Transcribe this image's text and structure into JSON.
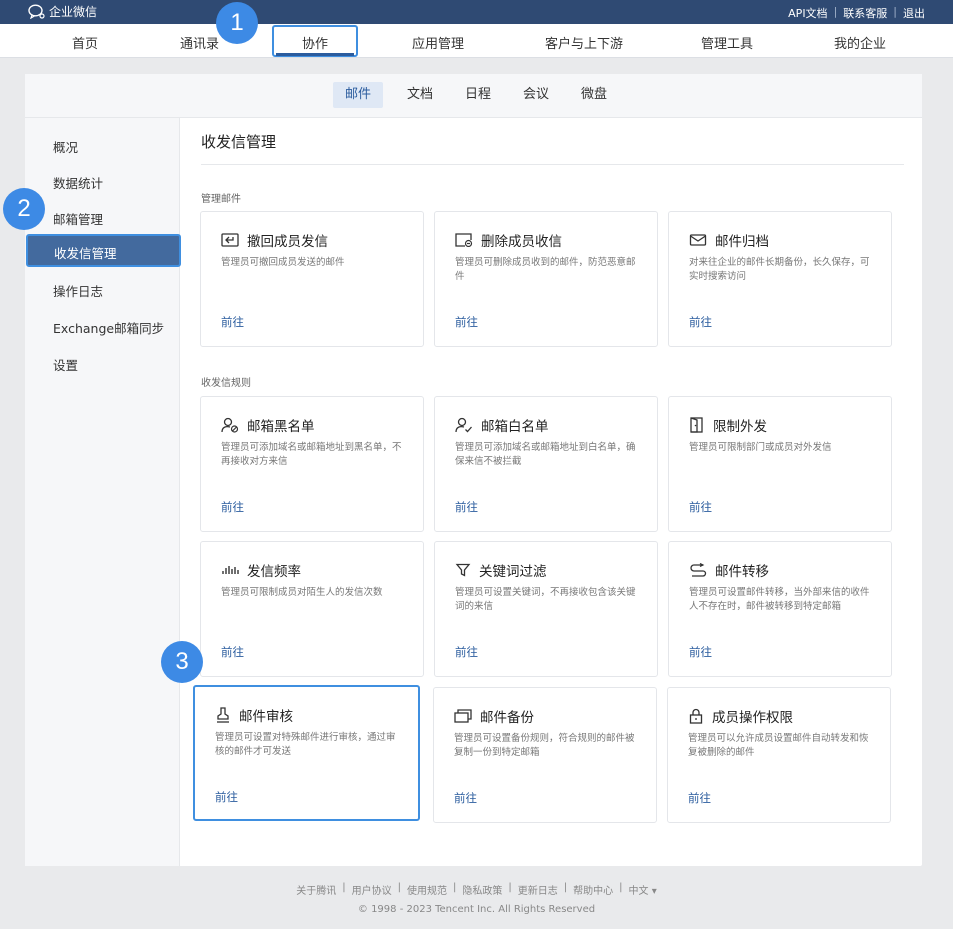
{
  "topbar": {
    "logo_text": "企业微信",
    "links": [
      "API文档",
      "联系客服",
      "退出"
    ]
  },
  "mainnav": {
    "items": [
      "首页",
      "通讯录",
      "协作",
      "应用管理",
      "客户与上下游",
      "管理工具",
      "我的企业"
    ],
    "active": "协作"
  },
  "badges": [
    "1",
    "2",
    "3"
  ],
  "subtabs": {
    "items": [
      "邮件",
      "文档",
      "日程",
      "会议",
      "微盘"
    ],
    "active": "邮件"
  },
  "sidebar": {
    "items": [
      "概况",
      "数据统计",
      "邮箱管理",
      "收发信管理",
      "操作日志",
      "Exchange邮箱同步",
      "设置"
    ],
    "active": "收发信管理"
  },
  "main": {
    "title": "收发信管理",
    "sections": [
      {
        "label": "管理邮件",
        "cards": [
          {
            "icon": "recall-mail-icon",
            "title": "撤回成员发信",
            "desc": "管理员可撤回成员发送的邮件",
            "link": "前往"
          },
          {
            "icon": "delete-mail-icon",
            "title": "删除成员收信",
            "desc": "管理员可删除成员收到的邮件，防范恶意邮件",
            "link": "前往"
          },
          {
            "icon": "archive-mail-icon",
            "title": "邮件归档",
            "desc": "对来往企业的邮件长期备份，长久保存，可实时搜索访问",
            "link": "前往"
          }
        ]
      },
      {
        "label": "收发信规则",
        "cards": [
          {
            "icon": "blacklist-user-icon",
            "title": "邮箱黑名单",
            "desc": "管理员可添加域名或邮箱地址到黑名单，不再接收对方来信",
            "link": "前往"
          },
          {
            "icon": "whitelist-user-icon",
            "title": "邮箱白名单",
            "desc": "管理员可添加域名或邮箱地址到白名单，确保来信不被拦截",
            "link": "前往"
          },
          {
            "icon": "door-exit-icon",
            "title": "限制外发",
            "desc": "管理员可限制部门或成员对外发信",
            "link": "前往"
          },
          {
            "icon": "frequency-bars-icon",
            "title": "发信频率",
            "desc": "管理员可限制成员对陌生人的发信次数",
            "link": "前往"
          },
          {
            "icon": "filter-funnel-icon",
            "title": "关键词过滤",
            "desc": "管理员可设置关键词，不再接收包含该关键词的来信",
            "link": "前往"
          },
          {
            "icon": "forward-mail-icon",
            "title": "邮件转移",
            "desc": "管理员可设置邮件转移，当外部来信的收件人不存在时，邮件被转移到特定邮箱",
            "link": "前往"
          },
          {
            "icon": "stamp-review-icon",
            "title": "邮件审核",
            "desc": "管理员可设置对特殊邮件进行审核，通过审核的邮件才可发送",
            "link": "前往"
          },
          {
            "icon": "backup-copy-icon",
            "title": "邮件备份",
            "desc": "管理员可设置备份规则，符合规则的邮件被复制一份到特定邮箱",
            "link": "前往"
          },
          {
            "icon": "lock-permission-icon",
            "title": "成员操作权限",
            "desc": "管理员可以允许成员设置邮件自动转发和恢复被删除的邮件",
            "link": "前往"
          }
        ]
      }
    ]
  },
  "footer": {
    "links": [
      "关于腾讯",
      "用户协议",
      "使用规范",
      "隐私政策",
      "更新日志",
      "帮助中心",
      "中文 ▾"
    ],
    "copyright": "© 1998 - 2023 Tencent Inc. All Rights Reserved"
  },
  "colors": {
    "topbar": "#2f4a73",
    "accent": "#2b5c9e",
    "highlight": "#3f8fe0",
    "badge": "#3d8ae5"
  }
}
